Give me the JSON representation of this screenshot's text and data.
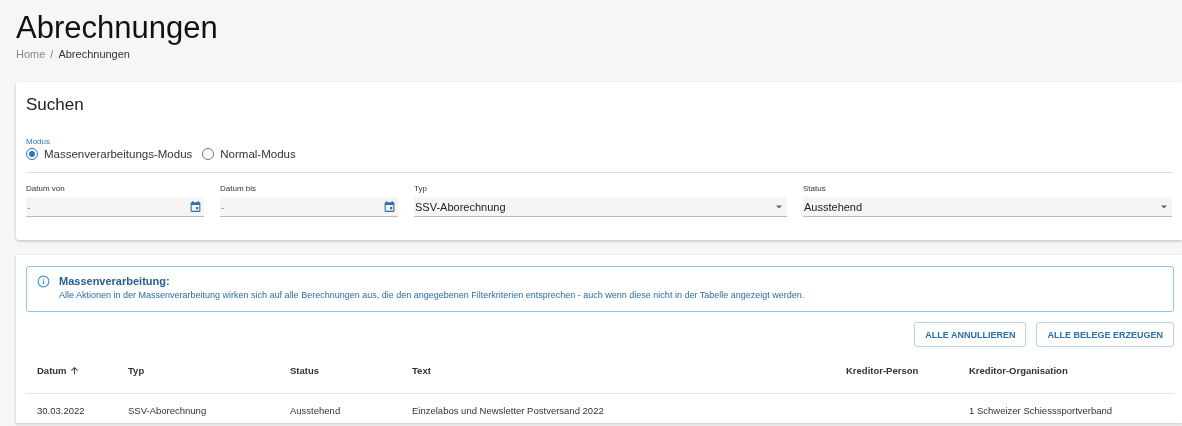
{
  "page": {
    "title": "Abrechnungen",
    "breadcrumb": [
      "Home",
      "Abrechnungen"
    ],
    "separator": "/"
  },
  "search": {
    "title": "Suchen",
    "mode_label": "Modus",
    "modes": [
      {
        "label": "Massenverarbeitungs-Modus",
        "selected": true
      },
      {
        "label": "Normal-Modus",
        "selected": false
      }
    ],
    "fields": [
      {
        "kind": "date",
        "label": "Datum von",
        "placeholder": "-"
      },
      {
        "kind": "date",
        "label": "Datum bis",
        "placeholder": "-"
      },
      {
        "kind": "select",
        "label": "Typ",
        "value": "SSV-Aborechnung"
      },
      {
        "kind": "select",
        "label": "Status",
        "value": "Ausstehend"
      }
    ]
  },
  "notice": {
    "title": "Massenverarbeitung:",
    "text": "Alle Aktionen in der Massenverarbeitung wirken sich auf alle Berechnungen aus, die den angegebenen Filterkriterien entsprechen - auch wenn diese nicht in der Tabelle angezeigt werden."
  },
  "actions": [
    "ALLE ANNULLIEREN",
    "ALLE BELEGE ERZEUGEN"
  ],
  "table": {
    "columns": [
      {
        "label": "Datum",
        "sorted": true
      },
      {
        "label": "Typ",
        "sorted": false
      },
      {
        "label": "Status",
        "sorted": false
      },
      {
        "label": "Text",
        "sorted": false
      },
      {
        "label": "Kreditor-Person",
        "sorted": false
      },
      {
        "label": "Kreditor-Organisation",
        "sorted": false
      }
    ],
    "rows": [
      [
        "30.03.2022",
        "SSV-Aborechnung",
        "Ausstehend",
        "Einzelabos und Newsletter Postversand 2022",
        "",
        "1 Schweizer Schiesssportverband"
      ]
    ]
  }
}
